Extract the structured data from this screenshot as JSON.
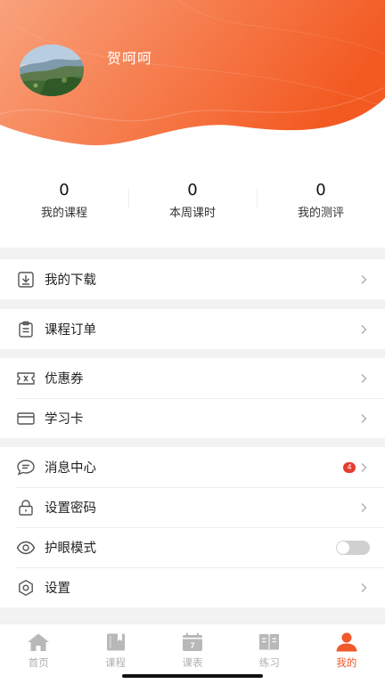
{
  "profile": {
    "username": "贺呵呵"
  },
  "stats": [
    {
      "value": "0",
      "label": "我的课程"
    },
    {
      "value": "0",
      "label": "本周课时"
    },
    {
      "value": "0",
      "label": "我的测评"
    }
  ],
  "menu": {
    "downloads": "我的下载",
    "orders": "课程订单",
    "coupons": "优惠券",
    "study_card": "学习卡",
    "messages": "消息中心",
    "messages_badge": "4",
    "password": "设置密码",
    "eye_mode": "护眼模式",
    "eye_mode_on": false,
    "settings": "设置"
  },
  "tabs": [
    {
      "label": "首页"
    },
    {
      "label": "课程"
    },
    {
      "label": "课表",
      "icon_text": "7"
    },
    {
      "label": "练习"
    },
    {
      "label": "我的"
    }
  ],
  "colors": {
    "accent": "#f1582a",
    "header_from": "#f9a07a",
    "header_to": "#f35a22",
    "inactive": "#b0b0b0"
  }
}
